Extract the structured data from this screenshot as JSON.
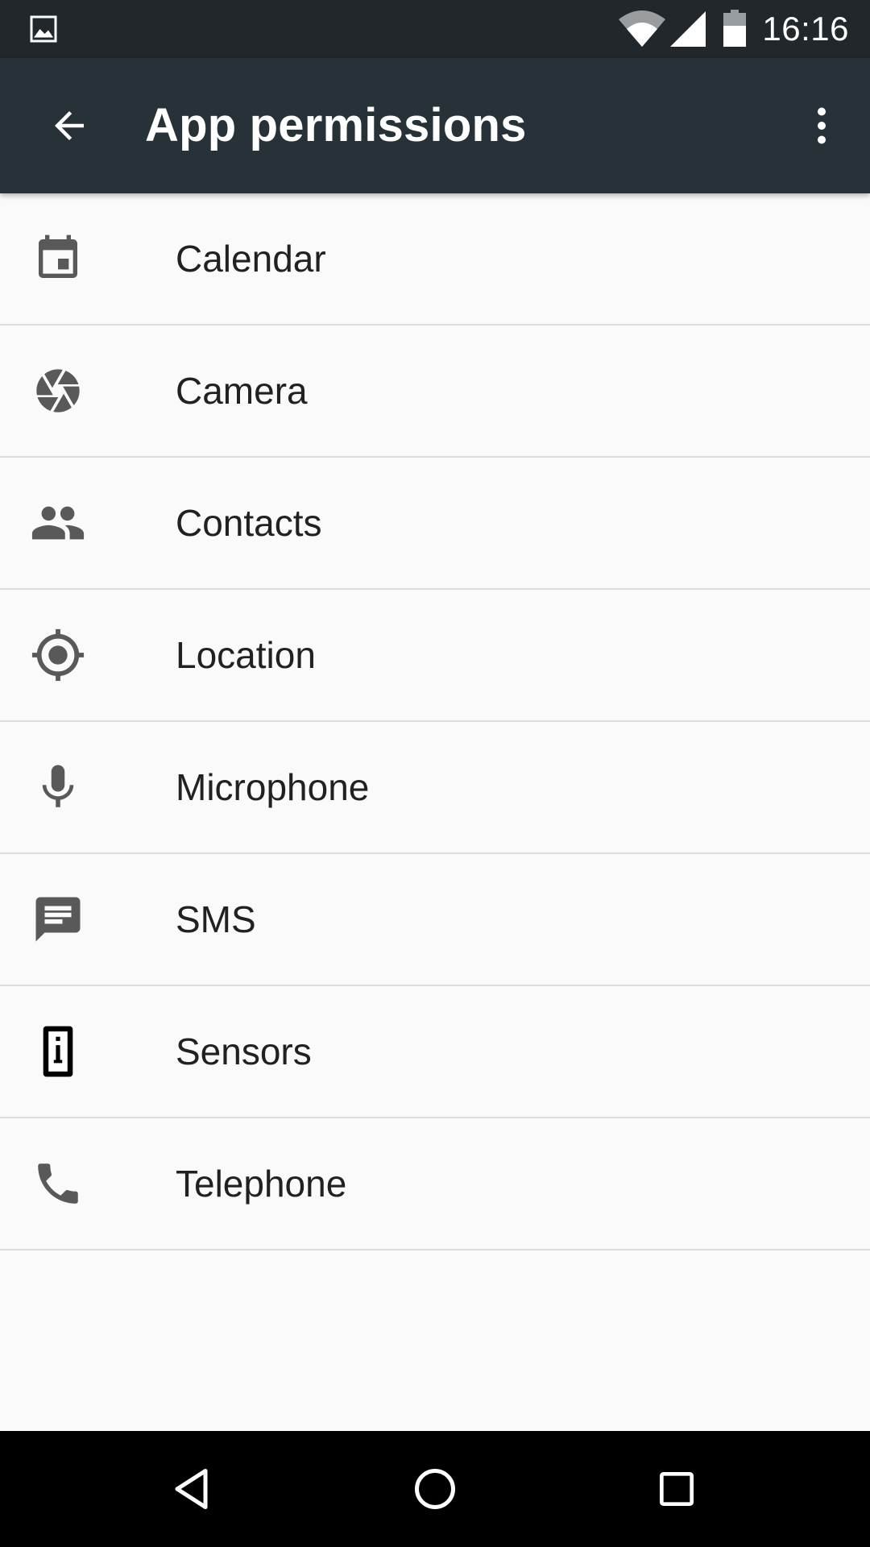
{
  "status_bar": {
    "time": "16:16",
    "icons": [
      "gallery-notification-icon",
      "wifi-icon",
      "cell-signal-icon",
      "battery-icon"
    ]
  },
  "toolbar": {
    "title": "App permissions",
    "back_icon": "arrow-back-icon",
    "overflow_icon": "more-vert-icon"
  },
  "permissions": [
    {
      "label": "Calendar",
      "icon": "calendar-icon"
    },
    {
      "label": "Camera",
      "icon": "camera-shutter-icon"
    },
    {
      "label": "Contacts",
      "icon": "people-icon"
    },
    {
      "label": "Location",
      "icon": "location-target-icon"
    },
    {
      "label": "Microphone",
      "icon": "microphone-icon"
    },
    {
      "label": "SMS",
      "icon": "message-icon"
    },
    {
      "label": "Sensors",
      "icon": "sensors-icon"
    },
    {
      "label": "Telephone",
      "icon": "phone-icon"
    }
  ],
  "nav_bar": {
    "icons": [
      "nav-back-icon",
      "nav-home-icon",
      "nav-recents-icon"
    ]
  },
  "colors": {
    "status_bar": "#21272b",
    "toolbar": "#263238",
    "background": "#fafafa",
    "divider": "#dcdcdc",
    "icon": "#595959",
    "text": "#212121"
  }
}
